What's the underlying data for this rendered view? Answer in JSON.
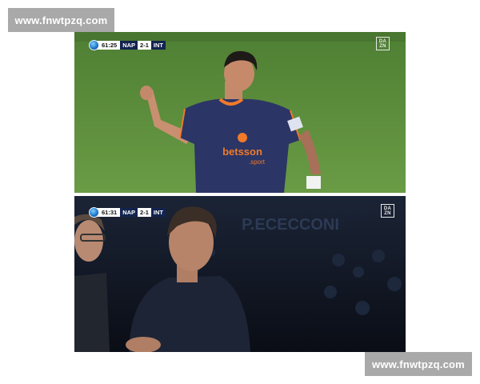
{
  "watermarks": {
    "top": "www.fnwtpzq.com",
    "bottom": "www.fnwtpzq.com"
  },
  "top_frame": {
    "scoreboard": {
      "time": "61:25",
      "home": "NAP",
      "score": "2-1",
      "away": "INT"
    },
    "broadcaster": {
      "line1": "DA",
      "line2": "ZN"
    },
    "shirt_sponsor": {
      "main": "betsson",
      "sub": ".sport"
    }
  },
  "bottom_frame": {
    "scoreboard": {
      "time": "61:31",
      "home": "NAP",
      "score": "2-1",
      "away": "INT"
    },
    "broadcaster": {
      "line1": "DA",
      "line2": "ZN"
    },
    "background_text": "P.ECECCONI"
  },
  "colors": {
    "pitch": "#5a8b3c",
    "kit_navy": "#2b3566",
    "kit_orange": "#f07a2a",
    "stadium_dark": "#0f1420"
  }
}
